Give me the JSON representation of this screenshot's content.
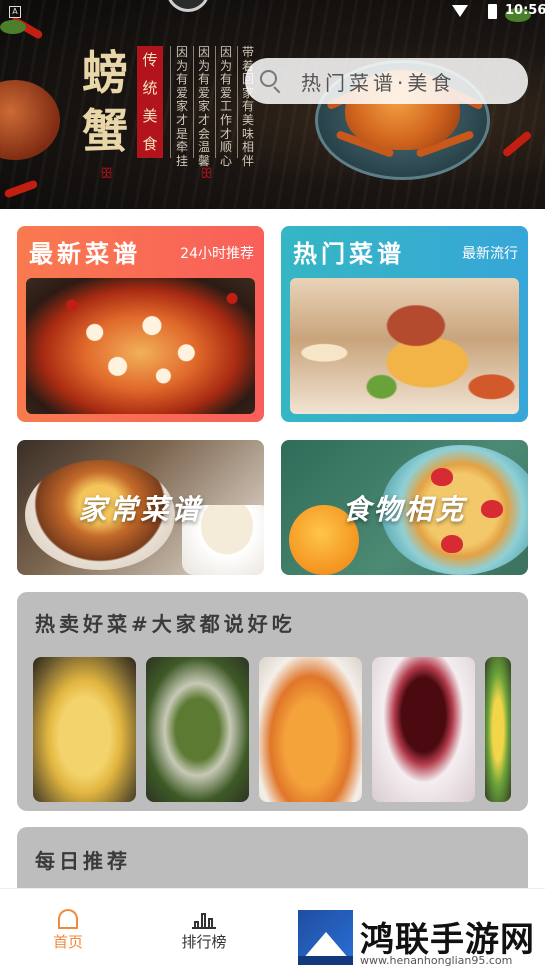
{
  "status_bar": {
    "time": "10:56",
    "left_icon": "A"
  },
  "banner": {
    "big_title": "螃蟹",
    "red_label": [
      "传",
      "统",
      "美",
      "食"
    ],
    "poem_columns": [
      "因为有爱家才是牵挂",
      "因为有爱家才会温馨",
      "因为有爱工作才顺心",
      "带着回家有美味相伴"
    ],
    "swirl": "ꕥ"
  },
  "search": {
    "placeholder": "热门菜谱·美食",
    "icon": "search-icon"
  },
  "cards": {
    "new": {
      "title": "最新菜谱",
      "subtitle": "24小时推荐",
      "color": "#f97a4f"
    },
    "hot": {
      "title": "热门菜谱",
      "subtitle": "最新流行",
      "color": "#35b6c4"
    },
    "home": {
      "overlay": "家常菜谱"
    },
    "food": {
      "overlay": "食物相克"
    }
  },
  "hot_section": {
    "title": "热卖好菜#大家都说好吃",
    "thumbnail_count": 5
  },
  "daily_section": {
    "title": "每日推荐"
  },
  "bottom_nav": {
    "home_label": "首页",
    "rank_label": "排行榜",
    "active_color": "#f08a3c"
  },
  "watermark": {
    "title": "鸿联手游网",
    "url": "www.henanhonglian95.com"
  }
}
